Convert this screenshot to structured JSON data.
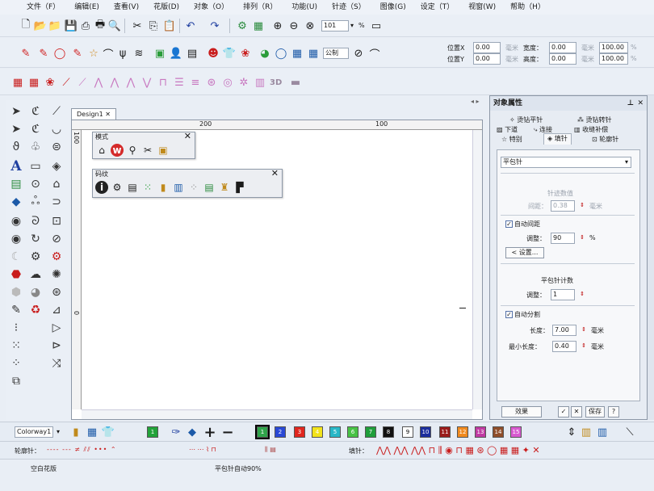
{
  "menu": [
    "文件（F）",
    "编辑(E)",
    "查看(V)",
    "花版(D)",
    "对象（O）",
    "排列（R）",
    "功能(U)",
    "针迹（S）",
    "图像(G)",
    "设定（T）",
    "视窗(W)",
    "帮助（H）"
  ],
  "toolbar1": {
    "zoom_value": "101",
    "zoom_unit": "%"
  },
  "toolbar2": {
    "unit_select": "公制",
    "pos_x_label": "位置X",
    "pos_x_value": "0.00",
    "pos_y_label": "位置Y",
    "pos_y_value": "0.00",
    "unit1": "毫米",
    "unit2": "毫米",
    "width_label": "宽度：",
    "width_value": "0.00",
    "height_label": "高度：",
    "height_value": "0.00",
    "unit3": "毫米",
    "unit4": "毫米",
    "pct1": "100.00",
    "pct2": "100.00",
    "pct_sym1": "%",
    "pct_sym2": "%"
  },
  "toolbar3": {
    "label_3d": "3D"
  },
  "document": {
    "tab": "Design1",
    "close": "✕",
    "ruler_marks": [
      "200",
      "100"
    ],
    "vruler_marks": [
      "100",
      "0"
    ]
  },
  "mode_panel": {
    "title": "模式",
    "close": "✕"
  },
  "code_panel": {
    "title": "码纹",
    "close": "✕"
  },
  "right_panel": {
    "title": "对象属性",
    "pin": "ᵖ",
    "close": "✕",
    "tabs_row1": [
      "烫钻平针",
      "烫钻转针"
    ],
    "tabs_row2": [
      "下道",
      "连接",
      "收缝补偿"
    ],
    "tabs_row3": [
      "特别",
      "填针",
      "轮廓针"
    ],
    "stitch_type": "平包针",
    "section_density": "针迹数值",
    "spacing_label": "间距：",
    "spacing_value": "0.38",
    "spacing_unit": "毫米",
    "auto_spacing": "自动间距",
    "adjust_label": "调整：",
    "adjust_value": "90",
    "adjust_unit": "%",
    "settings_btn": "设置...",
    "section_count": "平包针计数",
    "adjust2_label": "调整：",
    "adjust2_value": "1",
    "auto_split": "自动分割",
    "length_label": "长度：",
    "length_value": "7.00",
    "length_unit": "毫米",
    "minlen_label": "最小长度：",
    "minlen_value": "0.40",
    "minlen_unit": "毫米",
    "effects_btn": "效果",
    "save_btn": "保存",
    "help_btn": "?"
  },
  "bottom1": {
    "colorway": "Colorway1",
    "swatches": [
      {
        "n": "1",
        "c": "#22a33a"
      },
      {
        "n": "1",
        "c": "#2fa44a"
      },
      {
        "n": "2",
        "c": "#2a49d6"
      },
      {
        "n": "3",
        "c": "#e0261f"
      },
      {
        "n": "4",
        "c": "#f2e31b"
      },
      {
        "n": "5",
        "c": "#27b7c7"
      },
      {
        "n": "6",
        "c": "#48c246"
      },
      {
        "n": "7",
        "c": "#1f9e3b"
      },
      {
        "n": "8",
        "c": "#111111"
      },
      {
        "n": "9",
        "c": "#ffffff"
      },
      {
        "n": "10",
        "c": "#1c2e9c"
      },
      {
        "n": "11",
        "c": "#9a1b1b"
      },
      {
        "n": "12",
        "c": "#f08a1f"
      },
      {
        "n": "13",
        "c": "#c03aa3"
      },
      {
        "n": "14",
        "c": "#8f4d2a"
      },
      {
        "n": "15",
        "c": "#d85ad0"
      }
    ]
  },
  "bottom2": {
    "outline_label": "轮廓针：",
    "fill_label": "填针："
  },
  "status": {
    "left": "空白花版",
    "middle": "平包针自动90%"
  }
}
